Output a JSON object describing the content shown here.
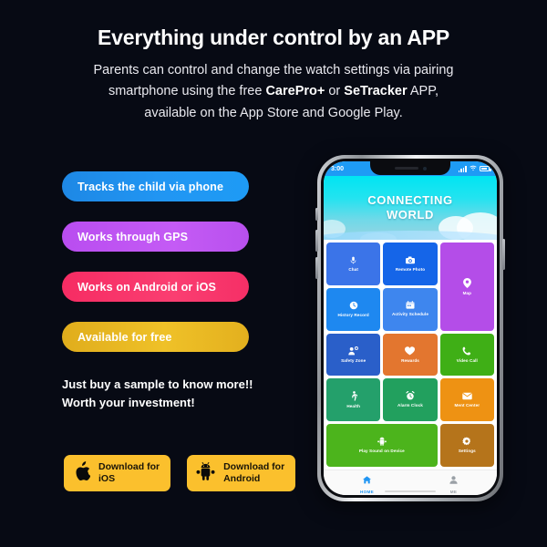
{
  "background_color": "#070a14",
  "header": {
    "headline": "Everything under control by an APP",
    "sub_line1_a": "Parents can control and change the watch settings via pairing",
    "sub_line2_a": "smartphone using the free ",
    "sub_line2_b": "CarePro+",
    "sub_line2_c": " or ",
    "sub_line2_d": "SeTracker",
    "sub_line2_e": " APP,",
    "sub_line3": "available on the App Store and Google Play."
  },
  "features": {
    "pills": [
      {
        "label": "Tracks the child via phone",
        "color": "#2196F3"
      },
      {
        "label": "Works through GPS",
        "color": "#C45BF5"
      },
      {
        "label": "Works on Android or iOS",
        "color": "#FA3E71"
      },
      {
        "label": "Available for free",
        "color": "#EFC128"
      }
    ]
  },
  "cta": {
    "line1": "Just buy a sample to know more!!",
    "line2": "Worth your investment!"
  },
  "downloads": {
    "button_color": "#FBC02D",
    "items": [
      {
        "icon": "apple-icon",
        "line1": "Download for",
        "line2": "iOS"
      },
      {
        "icon": "android-icon",
        "line1": "Download for",
        "line2": "Android"
      }
    ]
  },
  "phone": {
    "status_bar": {
      "time": "3:00",
      "signal_icon": "signal-bars-icon",
      "wifi_icon": "wifi-icon",
      "battery_icon": "battery-icon",
      "background": "#1E9BF5"
    },
    "banner": {
      "line1": "CONNECTING",
      "line2": "WORLD",
      "background": "#23E3F0"
    },
    "app_grid": [
      {
        "label": "Chat",
        "icon": "microphone-icon",
        "color": "#3B74E8",
        "span": 1
      },
      {
        "label": "Remote Photo",
        "icon": "camera-icon",
        "color": "#1565E8",
        "span": 1
      },
      {
        "label": "Map",
        "icon": "map-pin-icon",
        "color": "#B44DE8",
        "span": 2
      },
      {
        "label": "History Record",
        "icon": "history-icon",
        "color": "#1E88F0",
        "span": 1
      },
      {
        "label": "Activity Schedule",
        "icon": "calendar-icon",
        "color": "#3E86EE",
        "span": 1
      },
      {
        "label": "Safety Zone",
        "icon": "safety-zone-icon",
        "color": "#2A5FC9",
        "span": 1
      },
      {
        "label": "Rewards",
        "icon": "heart-icon",
        "color": "#E3762F",
        "span": 1
      },
      {
        "label": "Video Call",
        "icon": "video-call-icon",
        "color": "#3FAF16",
        "span": 1
      },
      {
        "label": "Health",
        "icon": "walking-icon",
        "color": "#24A06B",
        "span": 1
      },
      {
        "label": "Alarm Clock",
        "icon": "alarm-clock-icon",
        "color": "#22A05E",
        "span": 1
      },
      {
        "label": "Ment Center",
        "icon": "message-icon",
        "color": "#EE9213",
        "span": 1
      },
      {
        "label": "Play Sound on Device",
        "icon": "android-robot-icon",
        "color": "#4CB41C",
        "span": 2
      },
      {
        "label": "Settings",
        "icon": "gear-icon",
        "color": "#B5741B",
        "span": 1
      }
    ],
    "navbar": [
      {
        "label": "HOME",
        "icon": "home-icon",
        "active": true
      },
      {
        "label": "ME",
        "icon": "person-icon",
        "active": false
      }
    ]
  }
}
